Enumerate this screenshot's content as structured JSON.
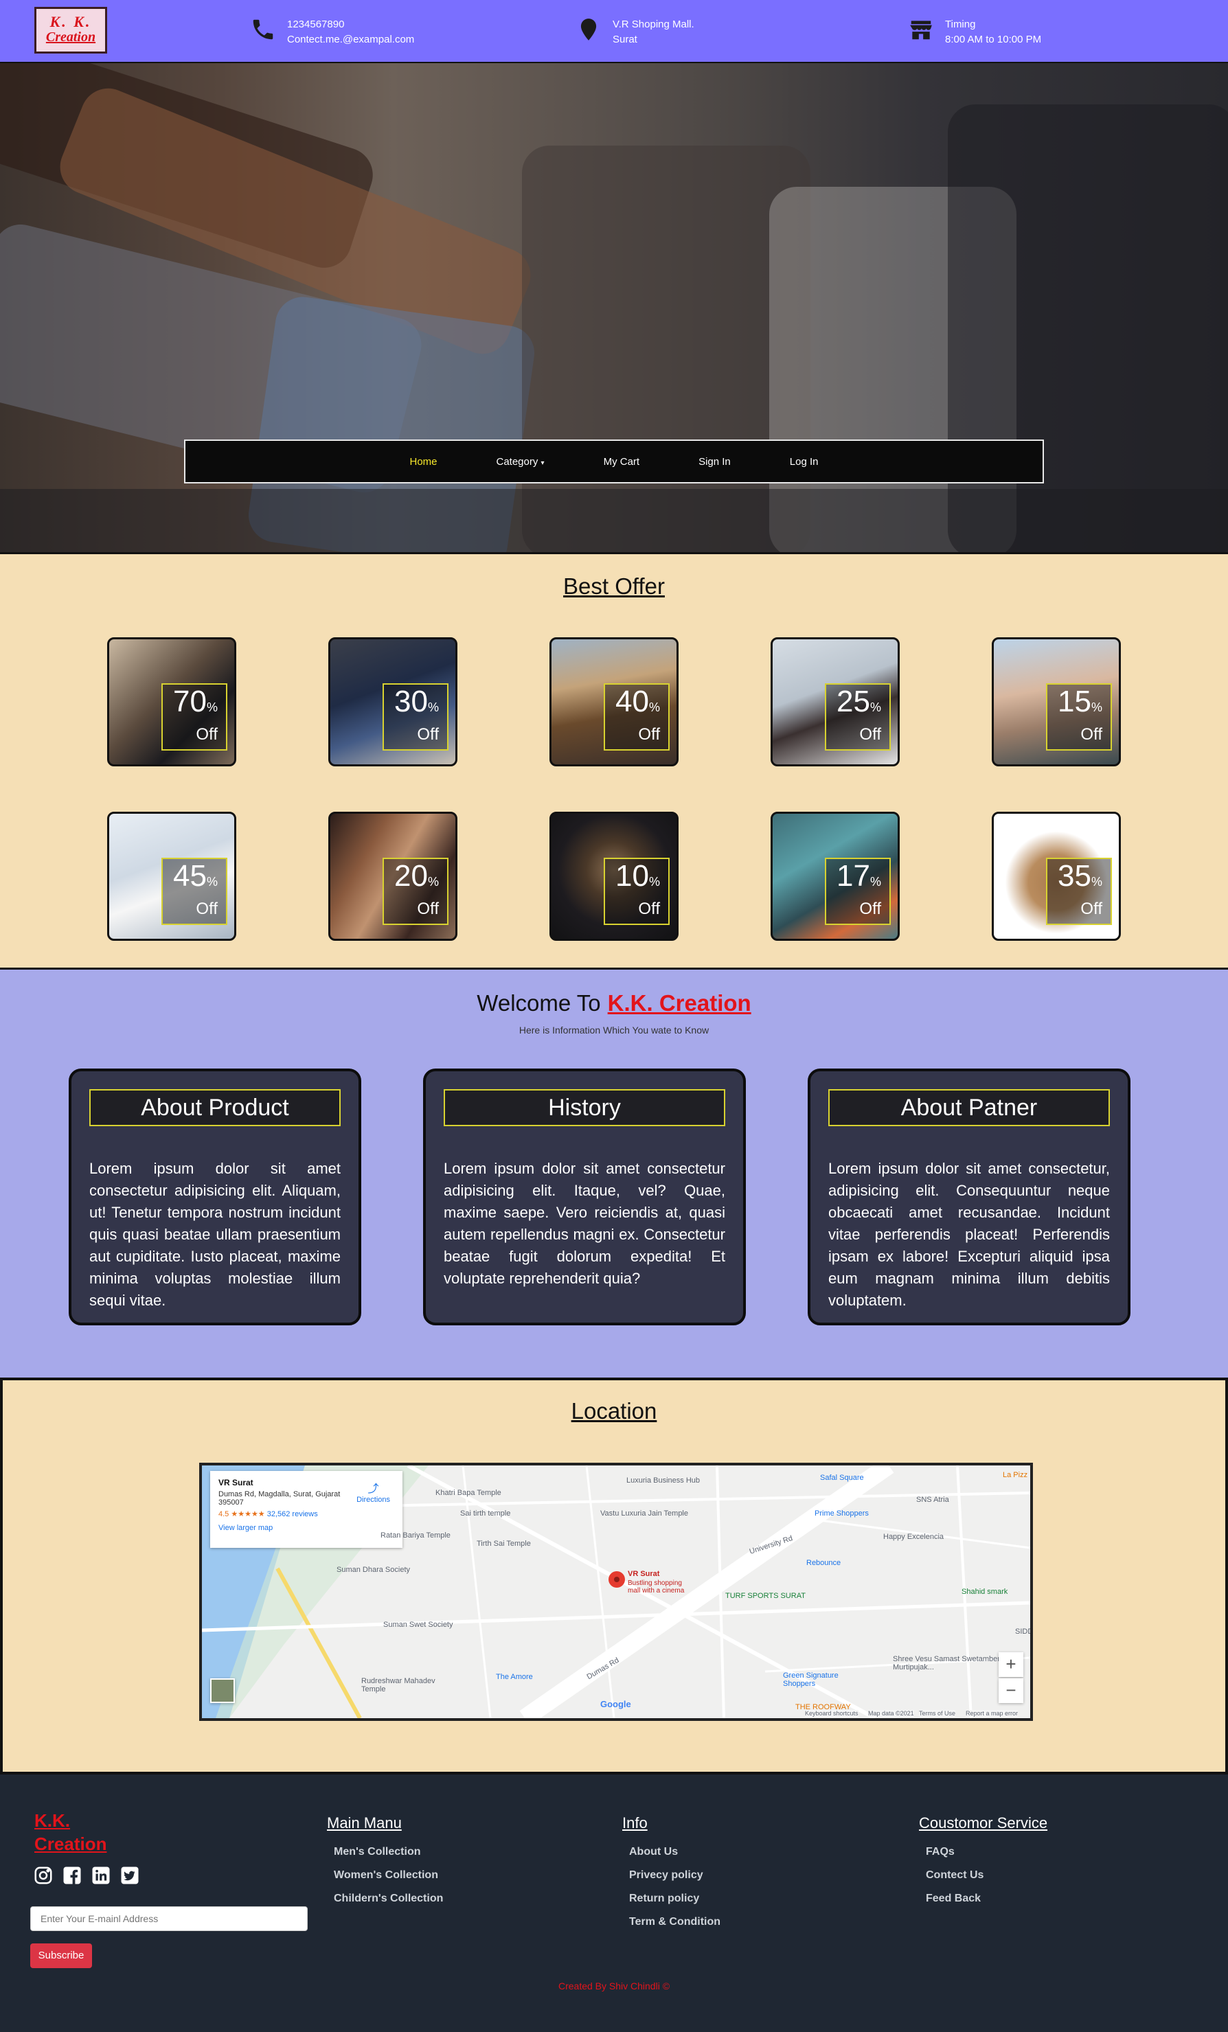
{
  "header": {
    "logo_line1": "K. K.",
    "logo_line2": "Creation",
    "phone": "1234567890",
    "email": "Contect.me.@exampal.com",
    "address_line1": "V.R Shoping Mall.",
    "address_line2": "Surat",
    "timing_label": "Timing",
    "timing_value": "8:00 AM to 10:00 PM"
  },
  "nav": {
    "items": [
      "Home",
      "Category",
      "My Cart",
      "Sign In",
      "Log In"
    ],
    "active": "Home"
  },
  "offers": {
    "title": "Best Offer",
    "percent_sign": "%",
    "off_label": "Off",
    "items": [
      {
        "value": "70",
        "theme": "shirts-on-shelf"
      },
      {
        "value": "30",
        "theme": "jackets-on-rack"
      },
      {
        "value": "40",
        "theme": "woman-in-hat"
      },
      {
        "value": "25",
        "theme": "woman-in-cap"
      },
      {
        "value": "15",
        "theme": "woman-in-coat"
      },
      {
        "value": "45",
        "theme": "white-dresses"
      },
      {
        "value": "20",
        "theme": "jewellery-display"
      },
      {
        "value": "10",
        "theme": "flower-brooch"
      },
      {
        "value": "17",
        "theme": "sneakers"
      },
      {
        "value": "35",
        "theme": "high-heels"
      }
    ]
  },
  "welcome": {
    "title_prefix": "Welcome To",
    "brand": "K.K. Creation",
    "subtitle": "Here is Information Which You wate to Know",
    "boxes": [
      {
        "title": "About Product",
        "text": "Lorem ipsum dolor sit amet consectetur adipisicing elit. Aliquam, ut! Tenetur tempora nostrum incidunt quis quasi beatae ullam praesentium aut cupiditate. Iusto placeat, maxime minima voluptas molestiae illum sequi vitae."
      },
      {
        "title": "History",
        "text": "Lorem ipsum dolor sit amet consectetur adipisicing elit. Itaque, vel? Quae, maxime saepe. Vero reiciendis at, quasi autem repellendus magni ex. Consectetur beatae fugit dolorum expedita! Et voluptate reprehenderit quia?"
      },
      {
        "title": "About Patner",
        "text": "Lorem ipsum dolor sit amet consectetur, adipisicing elit. Consequuntur neque obcaecati amet recusandae. Incidunt vitae perferendis placeat! Perferendis ipsam ex labore! Excepturi aliquid ipsa eum magnam minima illum debitis voluptatem."
      }
    ]
  },
  "location": {
    "title": "Location",
    "map": {
      "place_name": "VR Surat",
      "address": "Dumas Rd, Magdalla, Surat, Gujarat 395007",
      "rating": "4.5",
      "stars": "★★★★★",
      "reviews": "32,562 reviews",
      "directions": "Directions",
      "larger_map": "View larger map",
      "pin_title": "VR Surat",
      "pin_sub": "Bustling shopping mall with a cinema",
      "labels": {
        "luxuria": "Luxuria Business Hub",
        "safal": "Safal Square",
        "khatri": "Khatri Bapa Temple",
        "sai": "Sai tirth temple",
        "vastu": "Vastu Luxuria Jain Temple",
        "prime": "Prime Shoppers",
        "sns": "SNS Atria",
        "la": "La Pizz",
        "happy": "Happy Excelencia",
        "bariya": "Ratan Bariya Temple",
        "tirth": "Tirth Sai Temple",
        "sumandhara": "Suman Dhara Society",
        "rebounce": "Rebounce",
        "turf": "TURF SPORTS SURAT",
        "shahid": "Shahid smark",
        "sumanswet": "Suman Swet Society",
        "university": "University Rd",
        "amore": "The Amore",
        "green": "Green Signature Shoppers",
        "shree": "Shree Vesu Samast Swetamber Murtipujak...",
        "rudreshwar": "Rudreshwar Mahadev Temple",
        "dumas": "Dumas Rd",
        "roofway": "THE ROOFWAY",
        "sidd": "SIDD",
        "google": "Google",
        "shortcuts": "Keyboard shortcuts",
        "mapdata": "Map data ©2021",
        "terms": "Terms of Use",
        "report": "Report a map error"
      }
    }
  },
  "footer": {
    "logo_line1": "K.K.",
    "logo_line2": "Creation",
    "social": [
      "instagram-icon",
      "facebook-icon",
      "linkedin-icon",
      "twitter-icon"
    ],
    "email_placeholder": "Enter Your E-mainl Address",
    "subscribe": "Subscribe",
    "columns": [
      {
        "heading": "Main Manu",
        "items": [
          "Men's Collection",
          "Women's Collection",
          "Childern's Collection"
        ]
      },
      {
        "heading": "Info",
        "items": [
          "About Us",
          "Privecy policy",
          "Return policy",
          "Term & Condition"
        ]
      },
      {
        "heading": "Coustomor Service",
        "items": [
          "FAQs",
          "Contect Us",
          "Feed Back"
        ]
      }
    ],
    "credit": "Created By Shiv Chindli ©"
  }
}
